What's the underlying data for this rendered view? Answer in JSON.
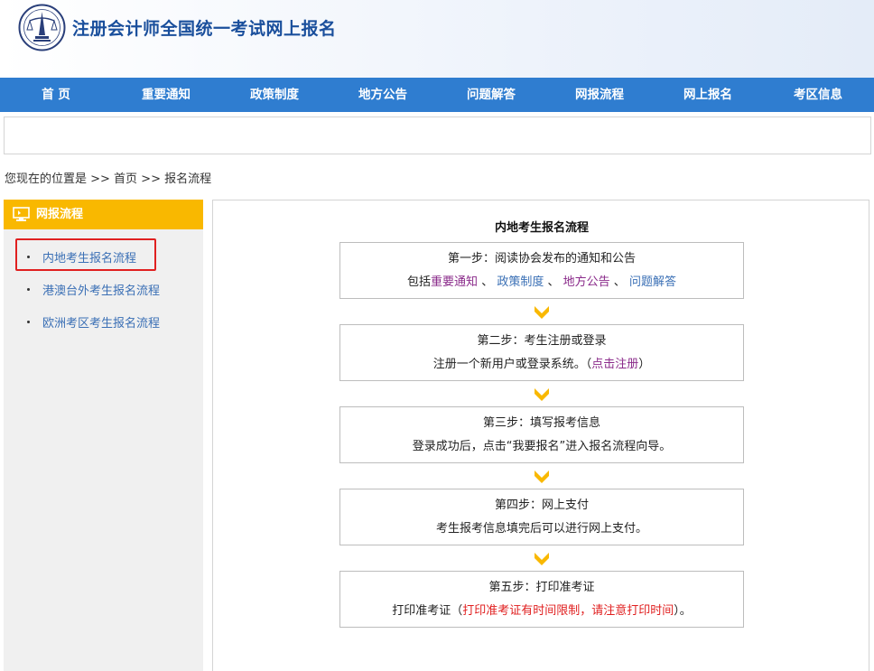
{
  "header": {
    "title": "注册会计师全国统一考试网上报名"
  },
  "nav": {
    "items": [
      "首 页",
      "重要通知",
      "政策制度",
      "地方公告",
      "问题解答",
      "网报流程",
      "网上报名",
      "考区信息"
    ]
  },
  "breadcrumb": {
    "text": "您现在的位置是 >> 首页 >> 报名流程"
  },
  "sidebar": {
    "title": "网报流程",
    "items": [
      "内地考生报名流程",
      "港澳台外考生报名流程",
      "欧洲考区考生报名流程"
    ]
  },
  "flow": {
    "title": "内地考生报名流程",
    "steps": [
      {
        "title": "第一步：阅读协会发布的通知和公告",
        "prefix": "包括",
        "link1": "重要通知",
        "sep1": " 、",
        "link2": "政策制度",
        "sep2": " 、",
        "link3": "地方公告",
        "sep3": " 、",
        "link4": "问题解答"
      },
      {
        "title": "第二步：考生注册或登录",
        "desc": "注册一个新用户或登录系统。（",
        "link": "点击注册",
        "suffix": "）"
      },
      {
        "title": "第三步：填写报考信息",
        "desc": "登录成功后，点击“我要报名”进入报名流程向导。"
      },
      {
        "title": "第四步：网上支付",
        "desc": "考生报考信息填完后可以进行网上支付。"
      },
      {
        "title": "第五步：打印准考证",
        "desc": "打印准考证（",
        "warning": "打印准考证有时间限制，请注意打印时间",
        "suffix": "）。"
      }
    ]
  },
  "colors": {
    "nav_bg": "#2f7dd0",
    "sidebar_header": "#f9b800",
    "arrow": "#f9b800",
    "highlight": "#e02020"
  }
}
